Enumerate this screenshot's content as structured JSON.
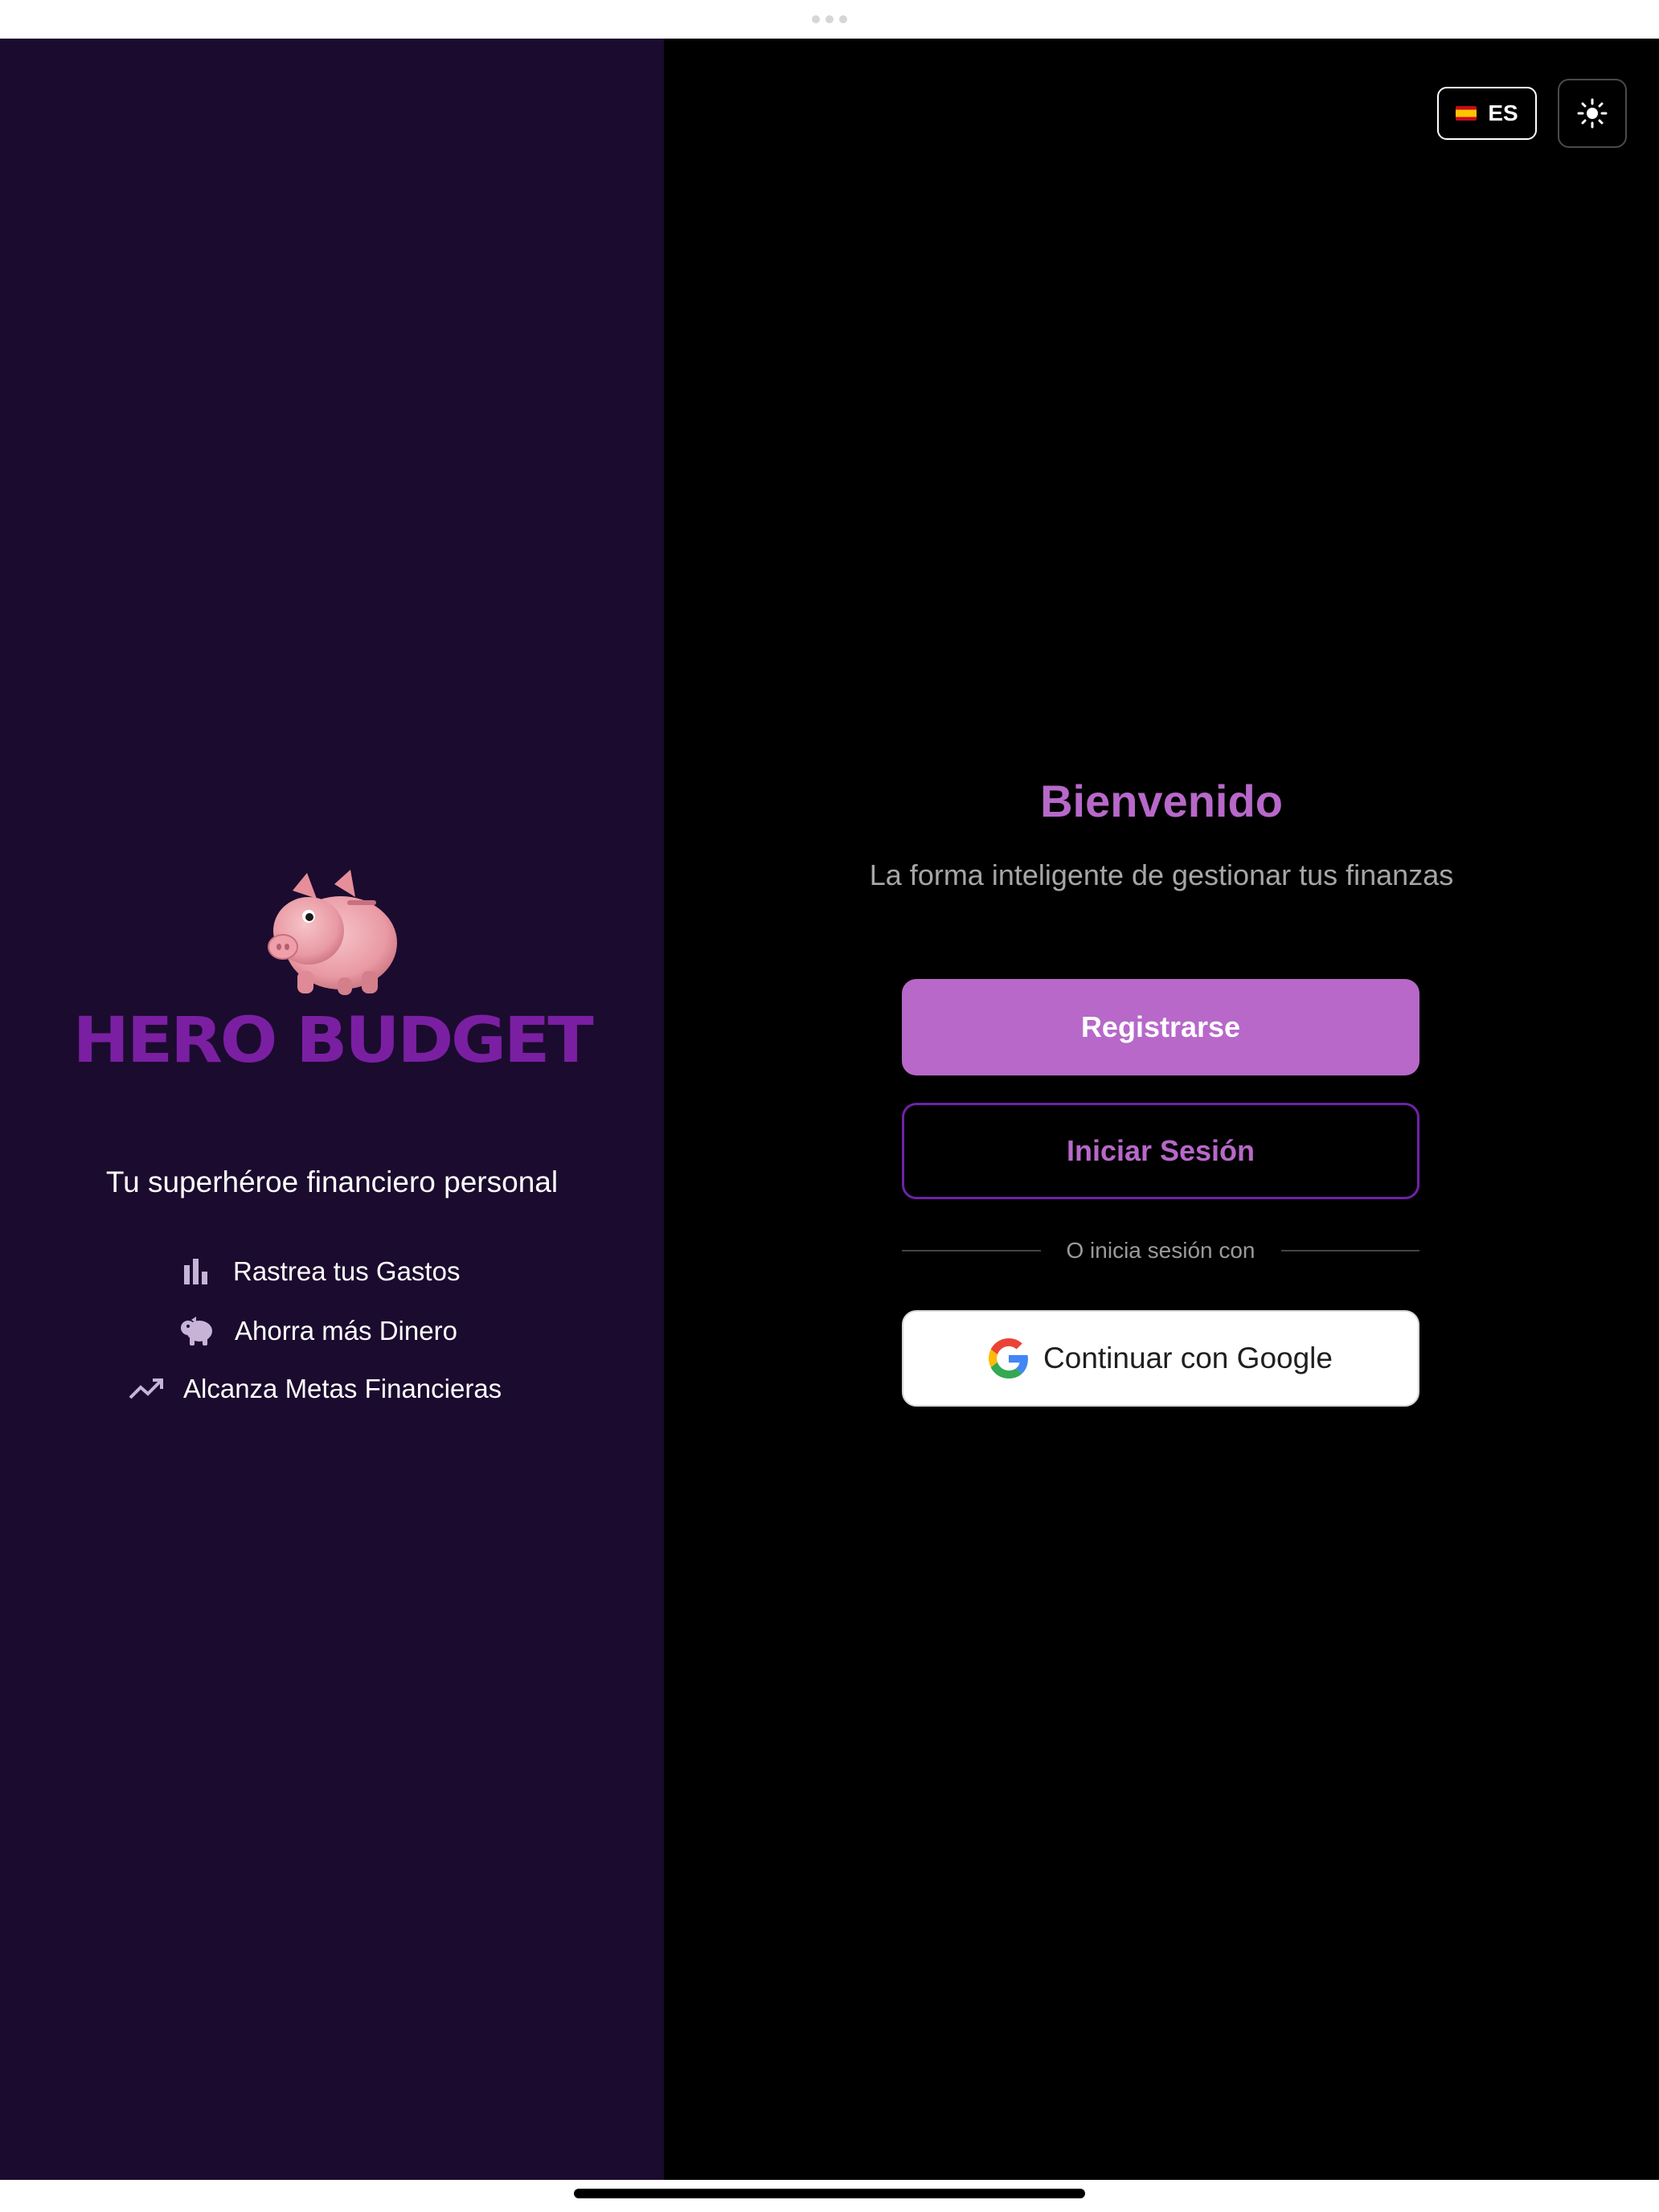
{
  "brand": {
    "name": "HERO BUDGET",
    "tagline": "Tu superhéroe financiero personal"
  },
  "features": [
    {
      "icon": "bar-chart-icon",
      "label": "Rastrea tus Gastos"
    },
    {
      "icon": "piggy-bank-icon",
      "label": "Ahorra más Dinero"
    },
    {
      "icon": "trending-up-icon",
      "label": "Alcanza Metas Financieras"
    }
  ],
  "header": {
    "language": {
      "code": "ES",
      "flag": "spain-flag-icon"
    },
    "theme_toggle": {
      "icon": "sun-icon"
    }
  },
  "auth": {
    "title": "Bienvenido",
    "subtitle": "La forma inteligente de gestionar tus finanzas",
    "register_label": "Registrarse",
    "login_label": "Iniciar Sesión",
    "divider_text": "O inicia sesión con",
    "google_label": "Continuar con Google"
  },
  "colors": {
    "left_background": "#1b0b2e",
    "accent": "#b768c9",
    "brand_purple": "#7a1fa2",
    "login_border": "#6f22a8"
  }
}
